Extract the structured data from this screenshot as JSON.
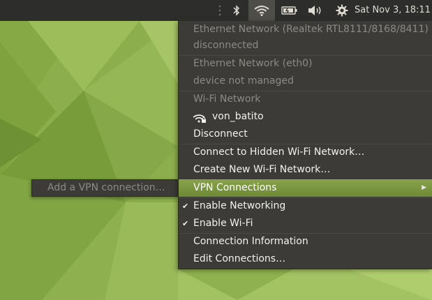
{
  "panel": {
    "clock": "Sat Nov 3, 18:11",
    "indicators": [
      {
        "icon": "drag-handle-icon"
      },
      {
        "icon": "bluetooth-icon"
      },
      {
        "icon": "wifi-icon",
        "active": true
      },
      {
        "icon": "battery-icon"
      },
      {
        "icon": "volume-icon"
      },
      {
        "icon": "system-gear-icon"
      }
    ]
  },
  "network_menu": {
    "ethernet1_title": "Ethernet Network (Realtek RTL8111/8168/8411)",
    "ethernet1_status": "disconnected",
    "ethernet2_title": "Ethernet Network (eth0)",
    "ethernet2_status": "device not managed",
    "wifi_title": "Wi-Fi Network",
    "wifi_connected_network": "von_batito",
    "disconnect": "Disconnect",
    "connect_hidden": "Connect to Hidden Wi-Fi Network…",
    "create_new": "Create New Wi-Fi Network…",
    "vpn_connections": "VPN Connections",
    "enable_networking": "Enable Networking",
    "enable_networking_checked": true,
    "enable_wifi": "Enable Wi-Fi",
    "enable_wifi_checked": true,
    "connection_information": "Connection Information",
    "edit_connections": "Edit Connections…"
  },
  "vpn_submenu": {
    "add_vpn": "Add a VPN connection…"
  },
  "colors": {
    "wallpaper_light": "#a9c767",
    "wallpaper_dark": "#6f9236",
    "menu_bg": "#3c3b37",
    "highlight": "#7c9740",
    "panel_bg": "#2d2d2b"
  }
}
